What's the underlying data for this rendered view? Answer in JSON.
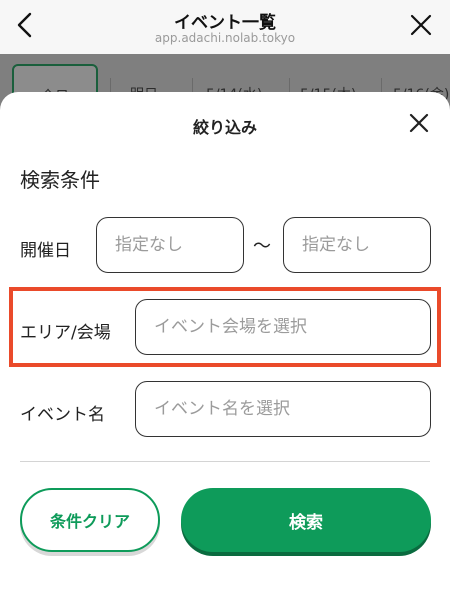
{
  "browser": {
    "title": "イベント一覧",
    "url": "app.adachi.nolab.tokyo"
  },
  "background_tabs": [
    "全日",
    "明日",
    "5/14(水)",
    "5/15(木)",
    "5/16(金)"
  ],
  "sheet": {
    "title": "絞り込み",
    "section_title": "検索条件",
    "date": {
      "label": "開催日",
      "from_placeholder": "指定なし",
      "separator": "〜",
      "to_placeholder": "指定なし"
    },
    "area": {
      "label": "エリア/会場",
      "placeholder": "イベント会場を選択"
    },
    "event_name": {
      "label": "イベント名",
      "placeholder": "イベント名を選択"
    },
    "clear_label": "条件クリア",
    "search_label": "検索"
  },
  "colors": {
    "accent_green": "#0e9b5a",
    "highlight_red": "#ea4a2a"
  },
  "icons": {
    "back": "chevron-left-icon",
    "close": "close-icon"
  }
}
